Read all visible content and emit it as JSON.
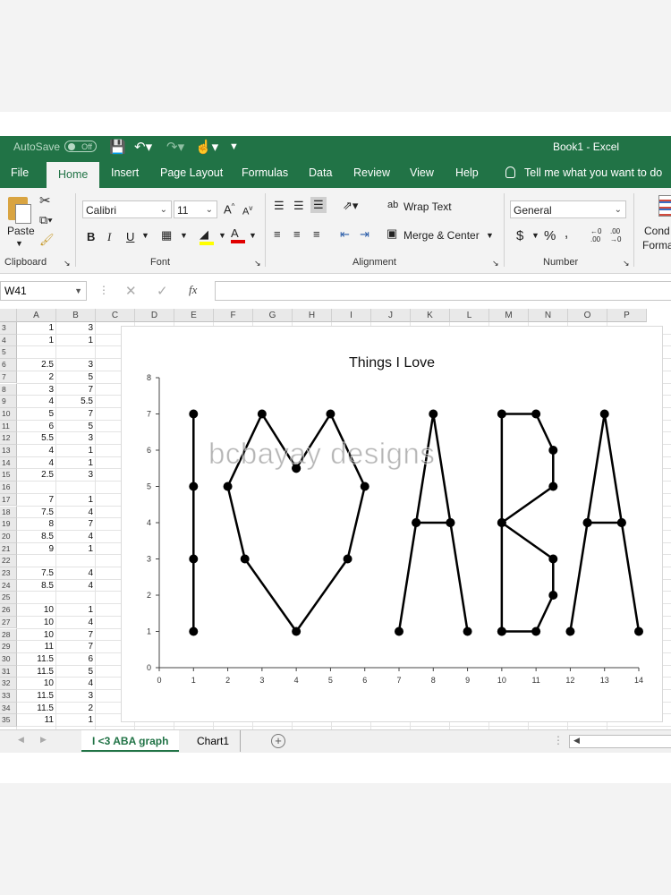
{
  "titlebar": {
    "autosave": "AutoSave",
    "toggle": "Off",
    "doc_title": "Book1  -  Excel"
  },
  "tabs": [
    "File",
    "Home",
    "Insert",
    "Page Layout",
    "Formulas",
    "Data",
    "Review",
    "View",
    "Help"
  ],
  "tell_me": "Tell me what you want to do",
  "clipboard": {
    "paste": "Paste",
    "label": "Clipboard"
  },
  "font": {
    "name": "Calibri",
    "size": "11",
    "label": "Font",
    "bold": "B",
    "italic": "I",
    "underline": "U"
  },
  "alignment": {
    "wrap": "Wrap Text",
    "merge": "Merge & Center",
    "label": "Alignment"
  },
  "number": {
    "format": "General",
    "label": "Number",
    "currency": "$",
    "percent": "%",
    "comma": ","
  },
  "styles": {
    "cond_top": "Cond",
    "cond_bottom": "Forma"
  },
  "formula_bar": {
    "namebox": "W41",
    "fx": "fx"
  },
  "columns": [
    "A",
    "B",
    "C",
    "D",
    "E",
    "F",
    "G",
    "H",
    "I",
    "J",
    "K",
    "L",
    "M",
    "N",
    "O",
    "P"
  ],
  "rows": [
    {
      "n": "3",
      "a": "1",
      "b": "3"
    },
    {
      "n": "4",
      "a": "1",
      "b": "1"
    },
    {
      "n": "5",
      "a": "",
      "b": ""
    },
    {
      "n": "6",
      "a": "2.5",
      "b": "3"
    },
    {
      "n": "7",
      "a": "2",
      "b": "5"
    },
    {
      "n": "8",
      "a": "3",
      "b": "7"
    },
    {
      "n": "9",
      "a": "4",
      "b": "5.5"
    },
    {
      "n": "10",
      "a": "5",
      "b": "7"
    },
    {
      "n": "11",
      "a": "6",
      "b": "5"
    },
    {
      "n": "12",
      "a": "5.5",
      "b": "3"
    },
    {
      "n": "13",
      "a": "4",
      "b": "1"
    },
    {
      "n": "14",
      "a": "4",
      "b": "1"
    },
    {
      "n": "15",
      "a": "2.5",
      "b": "3"
    },
    {
      "n": "16",
      "a": "",
      "b": ""
    },
    {
      "n": "17",
      "a": "7",
      "b": "1"
    },
    {
      "n": "18",
      "a": "7.5",
      "b": "4"
    },
    {
      "n": "19",
      "a": "8",
      "b": "7"
    },
    {
      "n": "20",
      "a": "8.5",
      "b": "4"
    },
    {
      "n": "21",
      "a": "9",
      "b": "1"
    },
    {
      "n": "22",
      "a": "",
      "b": ""
    },
    {
      "n": "23",
      "a": "7.5",
      "b": "4"
    },
    {
      "n": "24",
      "a": "8.5",
      "b": "4"
    },
    {
      "n": "25",
      "a": "",
      "b": ""
    },
    {
      "n": "26",
      "a": "10",
      "b": "1"
    },
    {
      "n": "27",
      "a": "10",
      "b": "4"
    },
    {
      "n": "28",
      "a": "10",
      "b": "7"
    },
    {
      "n": "29",
      "a": "11",
      "b": "7"
    },
    {
      "n": "30",
      "a": "11.5",
      "b": "6"
    },
    {
      "n": "31",
      "a": "11.5",
      "b": "5"
    },
    {
      "n": "32",
      "a": "10",
      "b": "4"
    },
    {
      "n": "33",
      "a": "11.5",
      "b": "3"
    },
    {
      "n": "34",
      "a": "11.5",
      "b": "2"
    },
    {
      "n": "35",
      "a": "11",
      "b": "1"
    }
  ],
  "watermark": "bcbayay designs",
  "sheets": [
    "I <3 ABA graph",
    "Chart1"
  ],
  "colors": {
    "excel_green": "#217346",
    "ribbon_bg": "#f3f3f3"
  },
  "chart_data": {
    "type": "scatter",
    "title": "Things I Love",
    "xlim": [
      0,
      14
    ],
    "ylim": [
      0,
      8
    ],
    "x_ticks": [
      0,
      1,
      2,
      3,
      4,
      5,
      6,
      7,
      8,
      9,
      10,
      11,
      12,
      13,
      14
    ],
    "y_ticks": [
      0,
      1,
      2,
      3,
      4,
      5,
      6,
      7,
      8
    ],
    "grid": false,
    "series": [
      {
        "points": [
          [
            1,
            7
          ],
          [
            1,
            5
          ],
          [
            1,
            3
          ],
          [
            1,
            1
          ]
        ]
      },
      {
        "points": [
          [
            4,
            5.5
          ],
          [
            3,
            7
          ],
          [
            2,
            5
          ],
          [
            2.5,
            3
          ],
          [
            4,
            1
          ],
          [
            5.5,
            3
          ],
          [
            6,
            5
          ],
          [
            5,
            7
          ],
          [
            4,
            5.5
          ]
        ]
      },
      {
        "points": [
          [
            7,
            1
          ],
          [
            7.5,
            4
          ],
          [
            8,
            7
          ],
          [
            8.5,
            4
          ],
          [
            9,
            1
          ]
        ]
      },
      {
        "points": [
          [
            7.5,
            4
          ],
          [
            8.5,
            4
          ]
        ]
      },
      {
        "points": [
          [
            10,
            1
          ],
          [
            10,
            4
          ],
          [
            10,
            7
          ],
          [
            11,
            7
          ],
          [
            11.5,
            6
          ],
          [
            11.5,
            5
          ],
          [
            10,
            4
          ],
          [
            11.5,
            3
          ],
          [
            11.5,
            2
          ],
          [
            11,
            1
          ],
          [
            10,
            1
          ]
        ]
      },
      {
        "points": [
          [
            12,
            1
          ],
          [
            12.5,
            4
          ],
          [
            13,
            7
          ],
          [
            13.5,
            4
          ],
          [
            14,
            1
          ]
        ]
      },
      {
        "points": [
          [
            12.5,
            4
          ],
          [
            13.5,
            4
          ]
        ]
      }
    ]
  }
}
